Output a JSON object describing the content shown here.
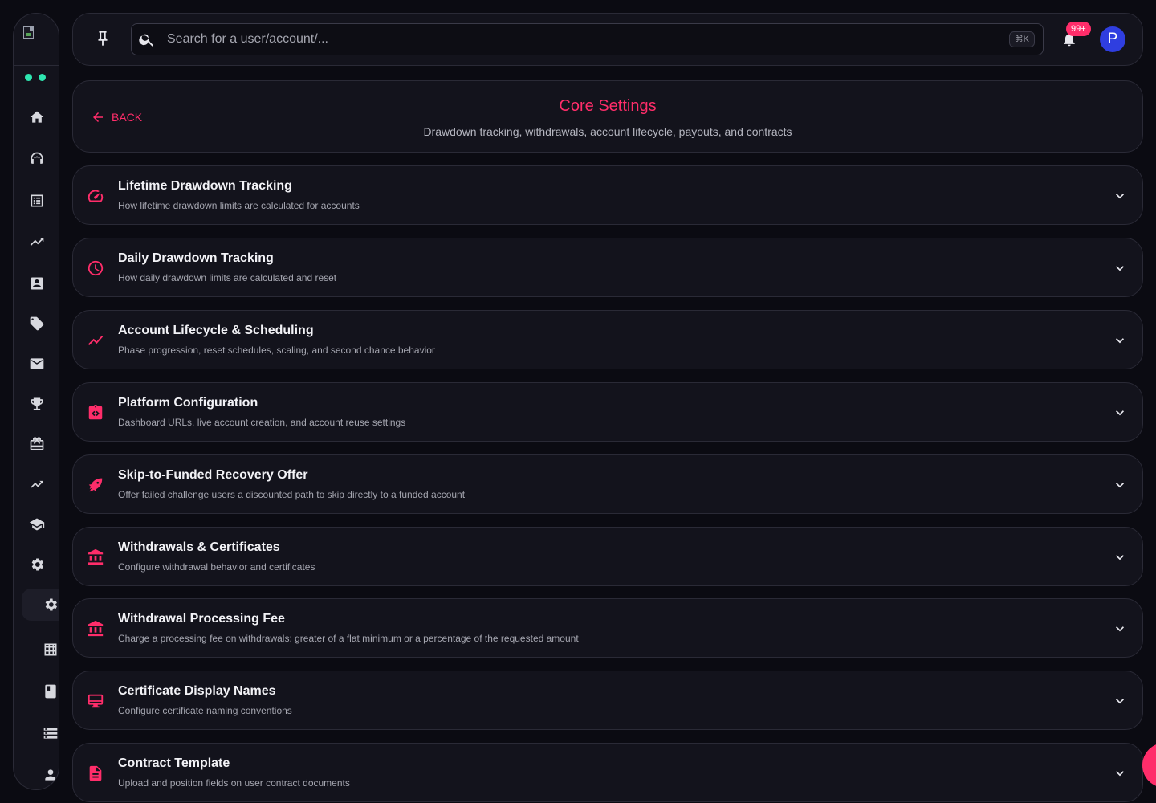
{
  "sidebar": {
    "logo_alt": "logo",
    "items": [
      {
        "name": "home-icon"
      },
      {
        "name": "headset-icon"
      },
      {
        "name": "list-icon"
      },
      {
        "name": "trending-icon"
      },
      {
        "name": "contact-icon"
      },
      {
        "name": "tag-icon"
      },
      {
        "name": "mail-icon"
      },
      {
        "name": "trophy-icon"
      },
      {
        "name": "gift-card-icon"
      },
      {
        "name": "trending-small-icon"
      },
      {
        "name": "school-icon"
      },
      {
        "name": "settings-icon"
      }
    ],
    "sub_items": [
      {
        "name": "settings-active-icon"
      },
      {
        "name": "grid-icon"
      },
      {
        "name": "book-icon"
      },
      {
        "name": "storage-icon"
      },
      {
        "name": "person-icon"
      }
    ]
  },
  "topbar": {
    "search_placeholder": "Search for a user/account/...",
    "shortcut": "⌘K",
    "notification_count": "99+",
    "avatar_initial": "P"
  },
  "header": {
    "back_label": "BACK",
    "title": "Core Settings",
    "subtitle": "Drawdown tracking, withdrawals, account lifecycle, payouts, and contracts"
  },
  "sections": [
    {
      "title": "Lifetime Drawdown Tracking",
      "desc": "How lifetime drawdown limits are calculated for accounts",
      "icon": "speedometer-icon"
    },
    {
      "title": "Daily Drawdown Tracking",
      "desc": "How daily drawdown limits are calculated and reset",
      "icon": "clock-icon"
    },
    {
      "title": "Account Lifecycle & Scheduling",
      "desc": "Phase progression, reset schedules, scaling, and second chance behavior",
      "icon": "trend-line-icon"
    },
    {
      "title": "Platform Configuration",
      "desc": "Dashboard URLs, live account creation, and account reuse settings",
      "icon": "code-clipboard-icon"
    },
    {
      "title": "Skip-to-Funded Recovery Offer",
      "desc": "Offer failed challenge users a discounted path to skip directly to a funded account",
      "icon": "rocket-icon"
    },
    {
      "title": "Withdrawals & Certificates",
      "desc": "Configure withdrawal behavior and certificates",
      "icon": "bank-icon"
    },
    {
      "title": "Withdrawal Processing Fee",
      "desc": "Charge a processing fee on withdrawals: greater of a flat minimum or a percentage of the requested amount",
      "icon": "bank-fee-icon"
    },
    {
      "title": "Certificate Display Names",
      "desc": "Configure certificate naming conventions",
      "icon": "certificate-icon"
    },
    {
      "title": "Contract Template",
      "desc": "Upload and position fields on user contract documents",
      "icon": "document-icon"
    }
  ],
  "colors": {
    "accent": "#ff2d6a",
    "background": "#0b0b12",
    "card": "#13131c",
    "status_dot": "#2ee6b0",
    "avatar": "#2f3ee0"
  }
}
